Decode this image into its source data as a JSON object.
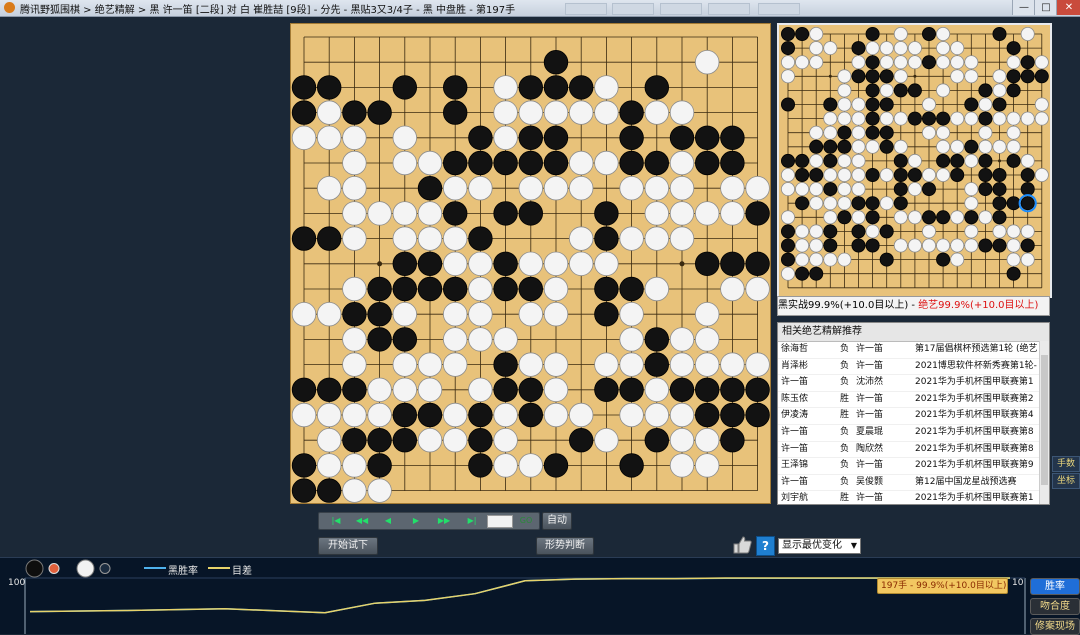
{
  "window": {
    "title": "腾讯野狐围棋 > 绝艺精解 > 黑 许一笛 [二段] 对 白 崔胜喆 [9段] - 分先 - 黑贴3又3/4子 - 黑 中盘胜 - 第197手",
    "btn_min": "—",
    "btn_max": "□",
    "btn_close": "✕"
  },
  "board": {
    "size": 19,
    "stones": [
      "0 ooB..BB.B.BB...BBBO",
      "1 OO..BBBOBBBB.......",
      "2 ...OB.BO.O...BB..O.",
      "3 .OO.BOBB....BB.BOOO",
      "4 .......BB.B.BB.BBBB",
      "5 OOO.O...O..OBBO.OO.",
      "6 ...O.OOO..O.OOO.O..",
      "7 ...OOB.OOB.BOOOOOBB",
      "8 ..O.O.OBOOBBO..OOO.",
      "9 B...BBBO.OBOOOOBBO."
    ],
    "grid": [
      "...................",
      "..........B.....O..",
      "BB..B.B.OBBBO.B....",
      "BOBB..B.OOOOOBOO...",
      "OOO.O..BOBB..B.BBB.",
      "..O.OOBBBBBOOBBOBB.",
      ".OO..BOO.OOO.OOO.OO",
      "..OOOOB.BB..B.OOOOB",
      "BBO.OOOB...OBOOO...",
      "....BBOOBOOOO...BBB",
      "..OBBBBOBBO.BBO..OO",
      "OOBBO.OO.OO.BO..O..",
      "..OBB.OOO....OBOO..",
      "..O.OOO.BOO.OOBOOOO",
      "BBBOOO.OBBO.BBOBBBB",
      "OOOOBBOBOBOO.OOOBBB",
      ".OBBBOOBO..BO.BOOB.",
      "BOOB...BOOB..B.OO..",
      "BBOO...............",
      "..................."
    ]
  },
  "mini_board": {
    "size": 19,
    "grid": [
      "BBO...B.O.BO...B.O.",
      "B.OO.BOOOO.OO...B..",
      "OOO..OBOOOBOOO..OBO",
      "O...OBBBO...OO.OBBB",
      "....O.BOBB.O..BOB..",
      "B..BOOBB..O..BOB..O",
      "...OOOBOOBBBOOBOOOO",
      "..OOBOBB..OO..O.O..",
      "..BBBOOBO..OOBOOO..",
      "BBOBOO..BO.BBOB.BO.",
      "OBBOOOBOBBOOB.BB.BO",
      "OOOBOO..BOB..OBB.B.",
      ".BOOOBBOB....O.BBB.",
      "O..OBOB.OOBBOBOB...",
      "BOOB.BOB..O..O.OOO.",
      "BOOB.BB.OOOOOOBBOB.",
      "BOOOO..B...BO...OO.",
      "OBB.............B..",
      "...................."
    ],
    "last_move": [
      17,
      12
    ]
  },
  "eval": {
    "black": "黑实战99.9%(+10.0目以上)",
    "sep": " - ",
    "ai": "绝艺99.9%(+10.0目以上)"
  },
  "records": {
    "header": "相关绝艺精解推荐",
    "rows": [
      {
        "p1": "徐海哲",
        "res": "负",
        "p2": "许一笛",
        "event": "第17届倡棋杯预选第1轮 (绝艺"
      },
      {
        "p1": "肖泽彬",
        "res": "负",
        "p2": "许一笛",
        "event": "2021博思软件杯新秀赛第1轮-"
      },
      {
        "p1": "许一笛",
        "res": "负",
        "p2": "沈沛然",
        "event": "2021华为手机杯围甲联赛第1"
      },
      {
        "p1": "陈玉侬",
        "res": "胜",
        "p2": "许一笛",
        "event": "2021华为手机杯围甲联赛第2"
      },
      {
        "p1": "伊凌涛",
        "res": "胜",
        "p2": "许一笛",
        "event": "2021华为手机杯围甲联赛第4"
      },
      {
        "p1": "许一笛",
        "res": "负",
        "p2": "夏晨琨",
        "event": "2021华为手机杯围甲联赛第8"
      },
      {
        "p1": "许一笛",
        "res": "负",
        "p2": "陶欣然",
        "event": "2021华为手机杯围甲联赛第8"
      },
      {
        "p1": "王泽锦",
        "res": "负",
        "p2": "许一笛",
        "event": "2021华为手机杯围甲联赛第9"
      },
      {
        "p1": "许一笛",
        "res": "负",
        "p2": "吴俊颢",
        "event": "第12届中国龙星战预选赛"
      },
      {
        "p1": "刘宇航",
        "res": "胜",
        "p2": "许一笛",
        "event": "2021华为手机杯围甲联赛第1"
      }
    ]
  },
  "side_tabs": {
    "moves": "手数",
    "coords": "坐标"
  },
  "nav": {
    "first": "|◀",
    "prev10": "◀◀",
    "prev": "◀",
    "next": "▶",
    "next10": "▶▶",
    "last": "▶|",
    "go": "GO",
    "auto": "自动"
  },
  "buttons": {
    "try": "开始试下",
    "judge": "形势判断"
  },
  "variation_select": {
    "value": "显示最优变化"
  },
  "legend": {
    "winrate": "黑胜率",
    "diff": "目差"
  },
  "chart_labels": {
    "left_max": "100",
    "right_max": "10"
  },
  "chart_tooltip": "197手 - 99.9%(+10.0目以上)",
  "chart_tabs": {
    "winrate": "胜率",
    "match": "吻合度",
    "replay": "修案现场"
  },
  "colors": {
    "board": "#e8c27a",
    "winrate_line": "#4fb2ee",
    "diff_line": "#e7d36a"
  },
  "chart_data": {
    "type": "line",
    "x": [
      1,
      20,
      40,
      60,
      70,
      80,
      90,
      100,
      110,
      120,
      130,
      140,
      150,
      160,
      170,
      180,
      197
    ],
    "series": [
      {
        "name": "黑胜率",
        "values": [
          40,
          42,
          45,
          38,
          55,
          60,
          72,
          95,
          98,
          99,
          99,
          99.5,
          99.6,
          99.7,
          99.8,
          99.9,
          99.9
        ]
      },
      {
        "name": "目差",
        "values": [
          4,
          4.2,
          4.5,
          3.8,
          5.5,
          6,
          7.2,
          9.5,
          9.8,
          9.9,
          9.9,
          10,
          10,
          10,
          10,
          10,
          10
        ]
      }
    ],
    "ylim": [
      0,
      100
    ]
  }
}
